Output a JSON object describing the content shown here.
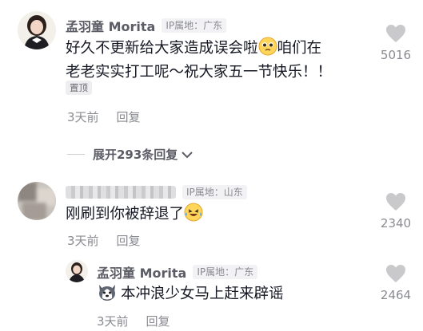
{
  "comments": [
    {
      "username": "孟羽童 Morita",
      "ip": "IP属地：广东",
      "text_line1": "好久不更新给大家造成误会啦",
      "text_line1b": "咱们在",
      "text_line2": "老老实实打工呢～祝大家五一节快乐！！",
      "pinned_label": "置顶",
      "time": "3天前",
      "reply_label": "回复",
      "likes": "5016"
    },
    {
      "username": "",
      "ip": "IP属地：山东",
      "text": "刚刷到你被辞退了",
      "time": "3天前",
      "reply_label": "回复",
      "likes": "2340"
    }
  ],
  "expand": {
    "label": "展开293条回复"
  },
  "reply": {
    "username": "孟羽童 Morita",
    "ip": "IP属地：广东",
    "text": "本冲浪少女马上赶来辟谣",
    "time": "3天前",
    "reply_label": "回复",
    "likes": "2464"
  },
  "colors": {
    "text": "#161823",
    "muted": "#8a8b91",
    "username": "#5c5c66",
    "heart": "#c9c9cc"
  },
  "icons": [
    "heart-icon",
    "chevron-down-icon",
    "pleading-face-emoji",
    "laughing-tears-emoji",
    "husky-emoji"
  ]
}
